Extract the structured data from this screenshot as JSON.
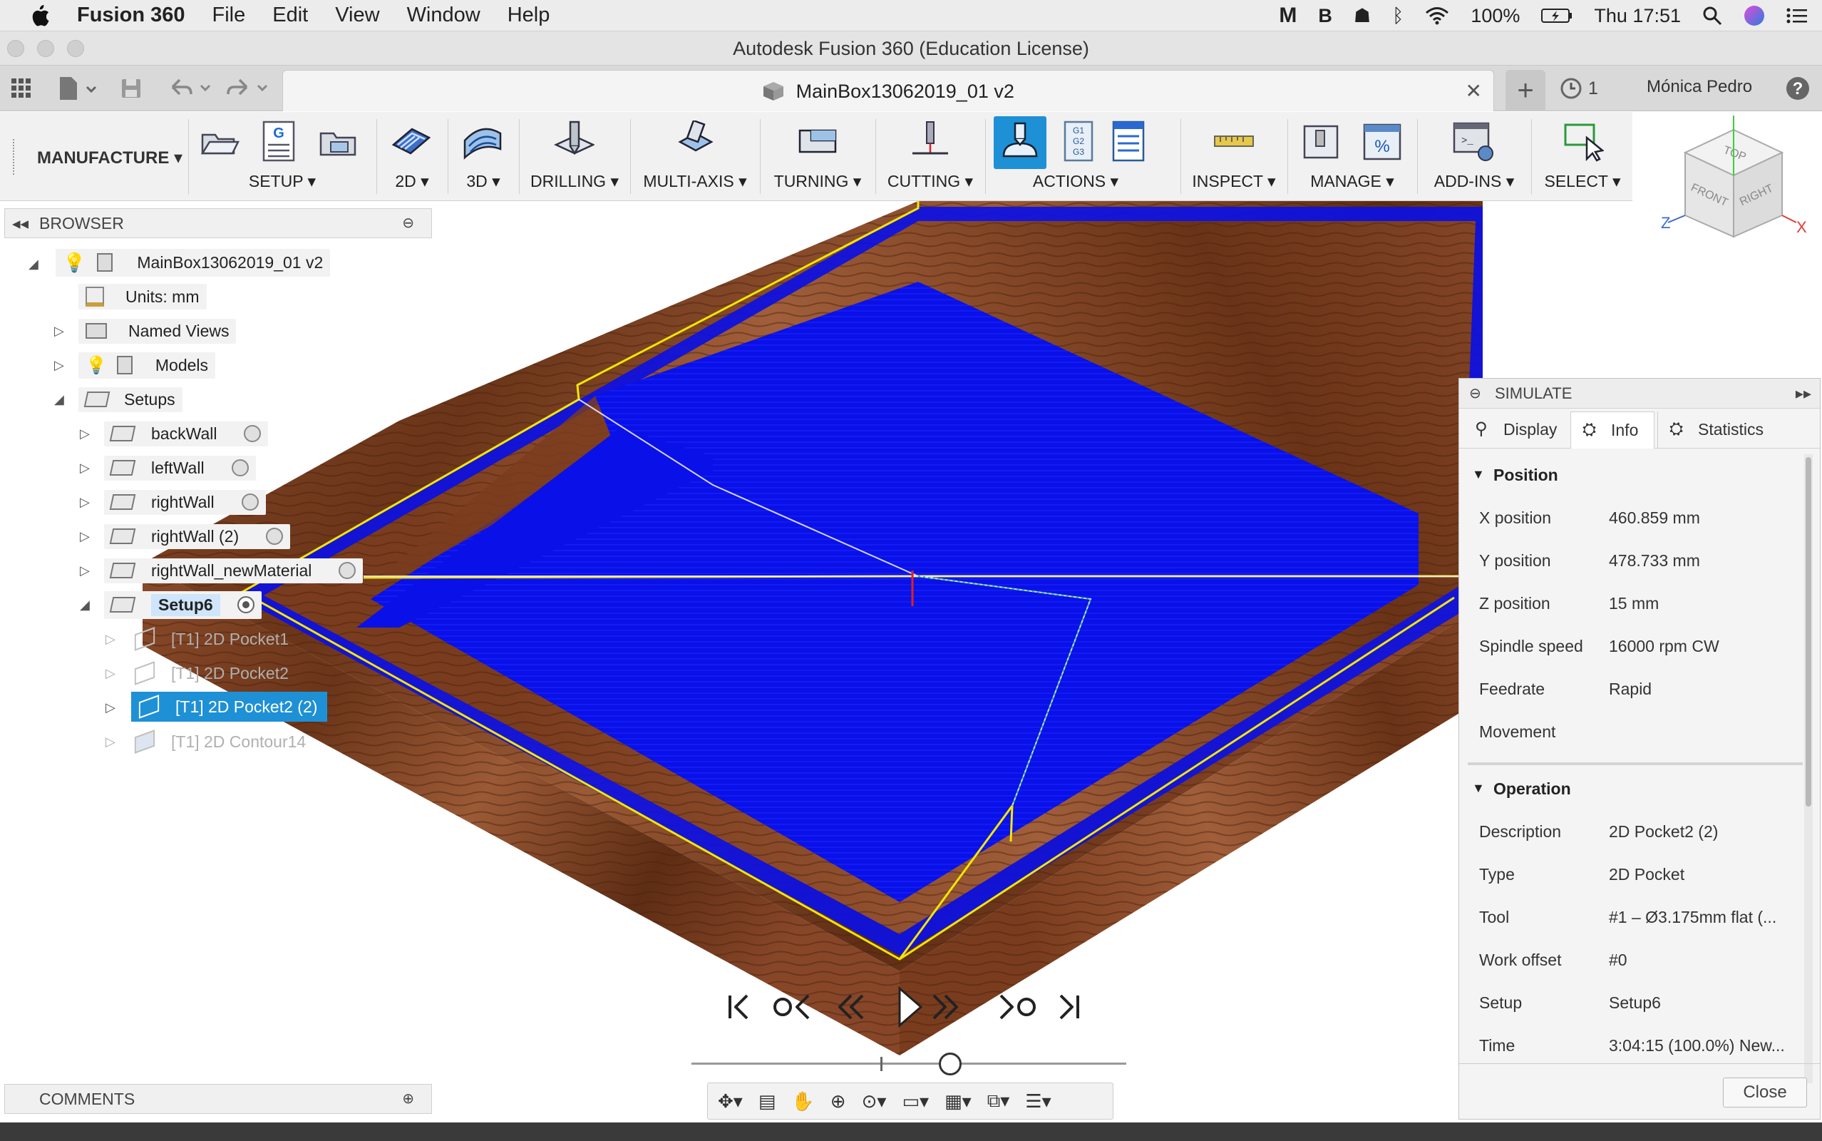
{
  "menubar": {
    "app_name": "Fusion 360",
    "items": [
      "File",
      "Edit",
      "View",
      "Window",
      "Help"
    ],
    "battery": "100%",
    "clock": "Thu 17:51"
  },
  "window": {
    "title": "Autodesk Fusion 360 (Education License)"
  },
  "tabbar": {
    "document_tab": "MainBox13062019_01 v2",
    "job_count": "1",
    "user": "Mónica Pedro"
  },
  "toolbar": {
    "workspace": "MANUFACTURE",
    "groups": [
      {
        "label": "SETUP"
      },
      {
        "label": "2D"
      },
      {
        "label": "3D"
      },
      {
        "label": "DRILLING"
      },
      {
        "label": "MULTI-AXIS"
      },
      {
        "label": "TURNING"
      },
      {
        "label": "CUTTING"
      },
      {
        "label": "ACTIONS"
      },
      {
        "label": "INSPECT"
      },
      {
        "label": "MANAGE"
      },
      {
        "label": "ADD-INS"
      },
      {
        "label": "SELECT"
      }
    ]
  },
  "viewcube": {
    "top": "TOP",
    "front": "FRONT",
    "right": "RIGHT",
    "x": "X",
    "y": "Y",
    "z": "Z"
  },
  "browser": {
    "title": "BROWSER",
    "root": "MainBox13062019_01 v2",
    "units": "Units: mm",
    "named_views": "Named Views",
    "models": "Models",
    "setups": "Setups",
    "setup_items": [
      "backWall",
      "leftWall",
      "rightWall",
      "rightWall (2)",
      "rightWall_newMaterial",
      "Setup6"
    ],
    "operations": [
      "[T1] 2D Pocket1",
      "[T1] 2D Pocket2",
      "[T1] 2D Pocket2 (2)",
      "[T1] 2D Contour14"
    ]
  },
  "comments": {
    "title": "COMMENTS"
  },
  "simulate": {
    "title": "SIMULATE",
    "tabs": [
      "Display",
      "Info",
      "Statistics"
    ],
    "active_tab": "Info",
    "position": {
      "title": "Position",
      "rows": [
        {
          "k": "X position",
          "v": "460.859 mm"
        },
        {
          "k": "Y position",
          "v": "478.733 mm"
        },
        {
          "k": "Z position",
          "v": "15 mm"
        },
        {
          "k": "Spindle speed",
          "v": "16000 rpm CW"
        },
        {
          "k": "Feedrate",
          "v": "Rapid"
        },
        {
          "k": "Movement",
          "v": ""
        }
      ]
    },
    "operation": {
      "title": "Operation",
      "rows": [
        {
          "k": "Description",
          "v": "2D Pocket2 (2)"
        },
        {
          "k": "Type",
          "v": "2D Pocket"
        },
        {
          "k": "Tool",
          "v": "#1 – Ø3.175mm flat (..."
        },
        {
          "k": "Work offset",
          "v": "#0"
        },
        {
          "k": "Setup",
          "v": "Setup6"
        },
        {
          "k": "Time",
          "v": "3:04:15 (100.0%) New..."
        }
      ]
    },
    "close_label": "Close"
  },
  "playback": {
    "progress": 0.6
  },
  "colors": {
    "accent": "#1e90d6",
    "stock_blue": "#0a10e8",
    "wood": "#7a3f22",
    "toolpath": "#f2e600"
  }
}
